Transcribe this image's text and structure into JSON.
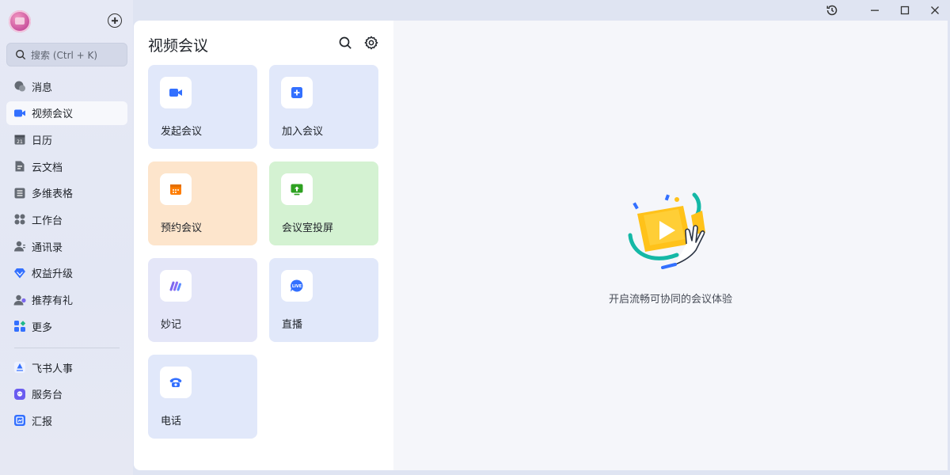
{
  "sidebar": {
    "search_placeholder": "搜索 (Ctrl + K)",
    "items": [
      {
        "label": "消息",
        "icon": "chat-icon"
      },
      {
        "label": "视频会议",
        "icon": "video-camera-icon",
        "active": true
      },
      {
        "label": "日历",
        "icon": "calendar-icon"
      },
      {
        "label": "云文档",
        "icon": "doc-icon"
      },
      {
        "label": "多维表格",
        "icon": "table-icon"
      },
      {
        "label": "工作台",
        "icon": "workbench-icon"
      },
      {
        "label": "通讯录",
        "icon": "contacts-icon"
      },
      {
        "label": "权益升级",
        "icon": "diamond-icon"
      },
      {
        "label": "推荐有礼",
        "icon": "gift-user-icon"
      },
      {
        "label": "更多",
        "icon": "more-grid-icon"
      }
    ],
    "apps": [
      {
        "label": "飞书人事",
        "icon": "hr-app-icon"
      },
      {
        "label": "服务台",
        "icon": "service-desk-icon"
      },
      {
        "label": "汇报",
        "icon": "report-icon"
      }
    ]
  },
  "panel": {
    "title": "视频会议",
    "tiles": [
      {
        "label": "发起会议",
        "icon": "video-camera-icon",
        "color": "#3370ff"
      },
      {
        "label": "加入会议",
        "icon": "plus-square-icon",
        "color": "#3370ff"
      },
      {
        "label": "预约会议",
        "icon": "calendar-icon",
        "color": "#ff7d00"
      },
      {
        "label": "会议室投屏",
        "icon": "screen-share-icon",
        "color": "#2ea121"
      },
      {
        "label": "妙记",
        "icon": "minutes-icon",
        "color": "#7b67ee"
      },
      {
        "label": "直播",
        "icon": "live-icon",
        "color": "#3370ff"
      },
      {
        "label": "电话",
        "icon": "phone-icon",
        "color": "#3370ff"
      }
    ]
  },
  "main": {
    "empty_text": "开启流畅可协同的会议体验"
  },
  "colors": {
    "accent": "#3370ff",
    "sidebar_bg": "#e4e8f5"
  }
}
